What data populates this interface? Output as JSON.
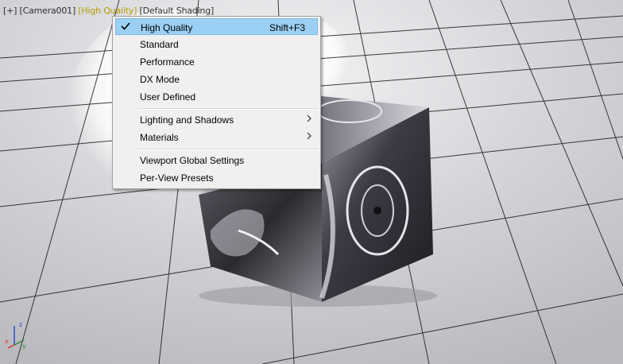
{
  "viewport": {
    "labels": {
      "plus": "[+]",
      "camera": "[Camera001]",
      "quality": "[High Quality]",
      "shading": "[Default Shading]"
    }
  },
  "menu": {
    "items": [
      {
        "label": "High Quality",
        "shortcut": "Shift+F3",
        "checked": true,
        "icon": "check-icon"
      },
      {
        "label": "Standard"
      },
      {
        "label": "Performance"
      },
      {
        "label": "DX Mode"
      },
      {
        "label": "User Defined"
      },
      {
        "label": "Lighting and Shadows",
        "submenu": true,
        "icon": "chevron-right-icon"
      },
      {
        "label": "Materials",
        "submenu": true,
        "icon": "chevron-right-icon"
      },
      {
        "label": "Viewport Global Settings"
      },
      {
        "label": "Per-View Presets"
      }
    ]
  },
  "axis": {
    "x": "x",
    "y": "y",
    "z": "z"
  },
  "colors": {
    "highlight": "#9bd0f4",
    "active_label": "#b89a00",
    "axis_x": "#e03030",
    "axis_y": "#2e8b2e",
    "axis_z": "#2e4fd0"
  }
}
